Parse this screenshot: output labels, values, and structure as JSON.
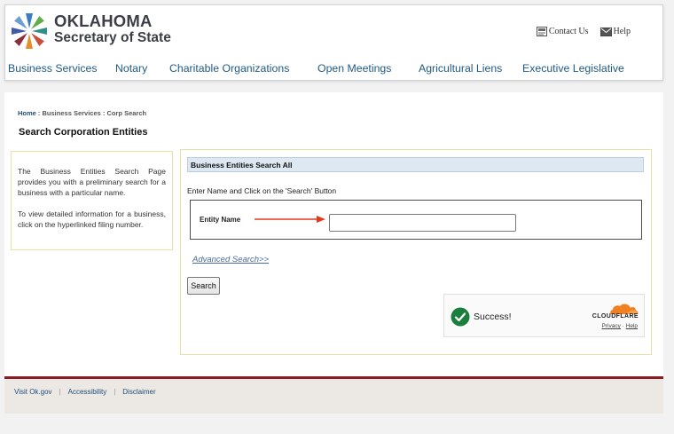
{
  "header": {
    "logo_line1": "OKLAHOMA",
    "logo_line2": "Secretary of State",
    "contact_label": "Contact Us",
    "help_label": "Help"
  },
  "nav": {
    "items": [
      "Business Services",
      "Notary",
      "Charitable Organizations",
      "Open Meetings",
      "Agricultural Liens",
      "Executive Legislative"
    ]
  },
  "breadcrumb": {
    "home": "Home",
    "separator": " : ",
    "section": "Business Services",
    "current": "Corp Search"
  },
  "page_title": "Search Corporation Entities",
  "info": {
    "paragraph1": "The Business Entities Search Page provides you with a preliminary search for a business with a particular name.",
    "paragraph2": "To view detailed information for a business, click on the hyperlinked filing number."
  },
  "form": {
    "heading": "Business Entities Search All",
    "instruction": "Enter Name and Click on the 'Search' Button",
    "entity_label": "Entity Name",
    "entity_value": "",
    "advanced_link": "Advanced Search>>",
    "search_button": "Search"
  },
  "captcha": {
    "status": "Success!",
    "brand": "CLOUDFLARE",
    "privacy": "Privacy",
    "dot": " · ",
    "help": "Help",
    "check_color": "#1a7f3c",
    "brand_color": "#f38020"
  },
  "footer": {
    "links": [
      "Visit Ok.gov",
      "Accessibility",
      "Disclaimer"
    ],
    "separator": "|",
    "accent_color": "#8b1d22"
  }
}
